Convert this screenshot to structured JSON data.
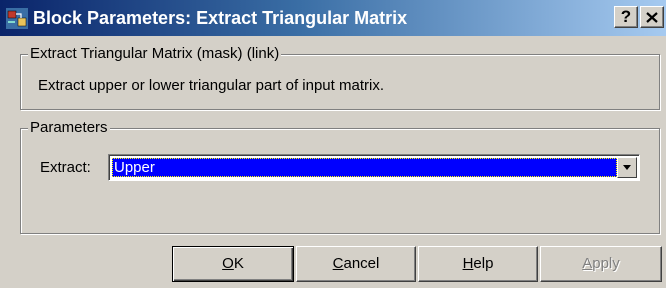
{
  "window": {
    "title": "Block Parameters: Extract Triangular Matrix",
    "help_button": "?",
    "close_button": "×"
  },
  "mask_group": {
    "legend": "Extract Triangular Matrix (mask) (link)",
    "description": "Extract upper or lower triangular part of input matrix."
  },
  "params_group": {
    "legend": "Parameters",
    "extract_label": "Extract:",
    "extract_value": "Upper"
  },
  "buttons": {
    "ok": {
      "mnemonic": "O",
      "rest": "K"
    },
    "cancel": {
      "mnemonic": "C",
      "rest": "ancel"
    },
    "help": {
      "mnemonic": "H",
      "rest": "elp"
    },
    "apply": {
      "mnemonic": "A",
      "rest": "pply",
      "disabled": true
    }
  },
  "icons": {
    "app": "simulink-block-icon",
    "dropdown": "chevron-down-icon"
  },
  "colors": {
    "title_bar": "#0a246a",
    "selection": "#0000ff",
    "face": "#d4d0c8"
  }
}
